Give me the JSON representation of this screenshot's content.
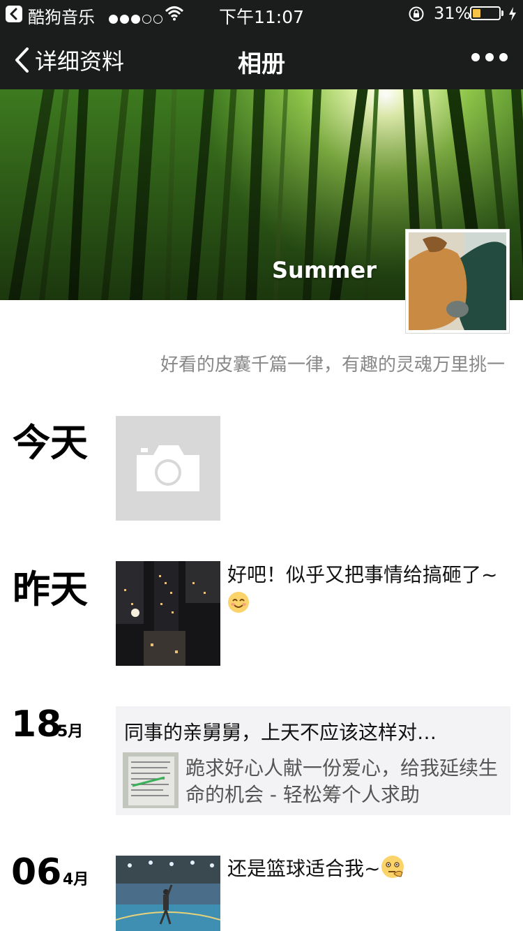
{
  "status_bar": {
    "back_app_name": "酷狗音乐",
    "time": "下午11:07",
    "battery_percent": "31%",
    "battery_level": 0.31,
    "signal_bars_filled": 3,
    "signal_bars_total": 5,
    "battery_color": "#f6c444"
  },
  "nav": {
    "back_label": "详细资料",
    "title": "相册",
    "more_icon": "more-icon"
  },
  "profile": {
    "username": "Summer",
    "signature": "好看的皮囊千篇一律，有趣的灵魂万里挑一"
  },
  "feed": {
    "today": {
      "label": "今天"
    },
    "yesterday": {
      "label": "昨天",
      "text": "好吧！似乎又把事情给搞砸了~"
    },
    "may18": {
      "day": "18",
      "month": "5月",
      "share_title": "同事的亲舅舅，上天不应该这样对…",
      "share_desc": "跪求好心人献一份爱心，给我延续生命的机会 - 轻松筹个人求助"
    },
    "apr06": {
      "day": "06",
      "month": "4月",
      "text": "还是篮球适合我~"
    }
  }
}
